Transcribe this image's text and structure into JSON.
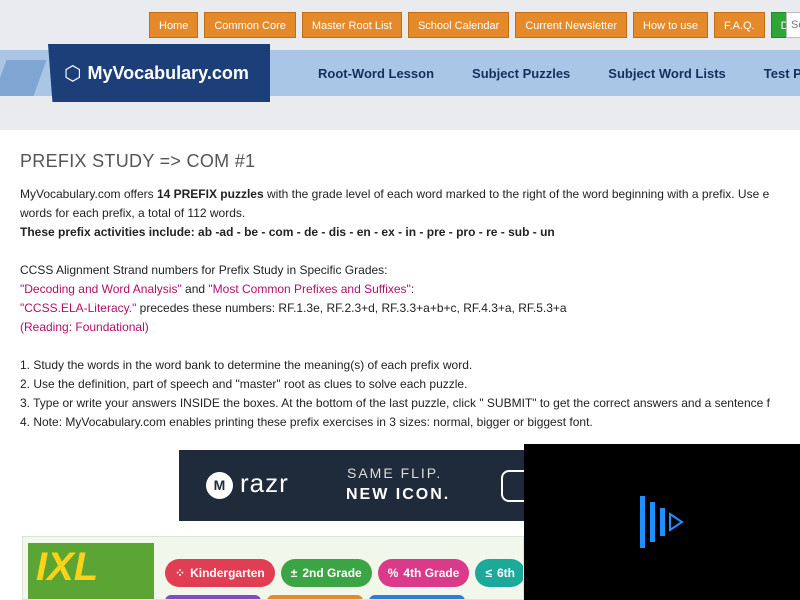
{
  "topnav": [
    "Home",
    "Common Core",
    "Master Root List",
    "School Calendar",
    "Current Newsletter",
    "How to use",
    "F.A.Q."
  ],
  "donate_label": "Donate",
  "search_placeholder": "Se",
  "logo": {
    "hex": "⬡",
    "name": "MyVocabulary.com"
  },
  "mainnav": [
    "Root-Word Lesson",
    "Subject Puzzles",
    "Subject Word Lists",
    "Test Pre"
  ],
  "page": {
    "title": "PREFIX STUDY => COM #1",
    "intro_part1": "MyVocabulary.com offers ",
    "intro_bold": "14 PREFIX puzzles",
    "intro_part2": " with the grade level of each word marked to the right of the word beginning with a prefix. Use e",
    "intro_line2": "words for each prefix, a total of 112 words.",
    "activities": "These prefix activities include: ab -ad - be - com - de - dis - en - ex - in - pre - pro - re - sub - un",
    "ccss_heading": "CCSS Alignment Strand numbers for Prefix Study in Specific Grades:",
    "link1": "\"Decoding and Word Analysis\"",
    "and_text": " and ",
    "link2": "\"Most Common Prefixes and Suffixes\"",
    "colon": ":",
    "link3": "\"CCSS.ELA-Literacy.\"",
    "precedes": " precedes these numbers: RF.1.3e, RF.2.3+d, RF.3.3+a+b+c, RF.4.3+a, RF.5.3+a",
    "link4": "(Reading: Foundational)",
    "steps": [
      "1. Study the words in the word bank to determine the meaning(s) of each prefix word.",
      "2. Use the definition, part of speech and \"master\" root as clues to solve each puzzle.",
      "3. Type or write your answers INSIDE the boxes. At the bottom of the last puzzle, click \" SUBMIT\" to get the correct answers and a sentence f",
      "4. Note: MyVocabulary.com enables printing these prefix exercises in 3 sizes: normal, bigger or biggest font."
    ]
  },
  "ad": {
    "brand_mark": "M",
    "brand": "razr",
    "line1": "SAME FLIP.",
    "line2": "NEW ICON."
  },
  "ixl": {
    "logo": "IXL",
    "grades": [
      {
        "icon": "⁘",
        "label": "Kindergarten"
      },
      {
        "icon": "±",
        "label": "2nd Grade"
      },
      {
        "icon": "%",
        "label": "4th Grade"
      },
      {
        "icon": "≤",
        "label": "6th"
      }
    ]
  },
  "colors": {
    "orange": "#e48a2a",
    "green": "#2ea636",
    "navy": "#1c3f7a",
    "link": "#b0106a",
    "light_blue": "#a9c6e6"
  }
}
